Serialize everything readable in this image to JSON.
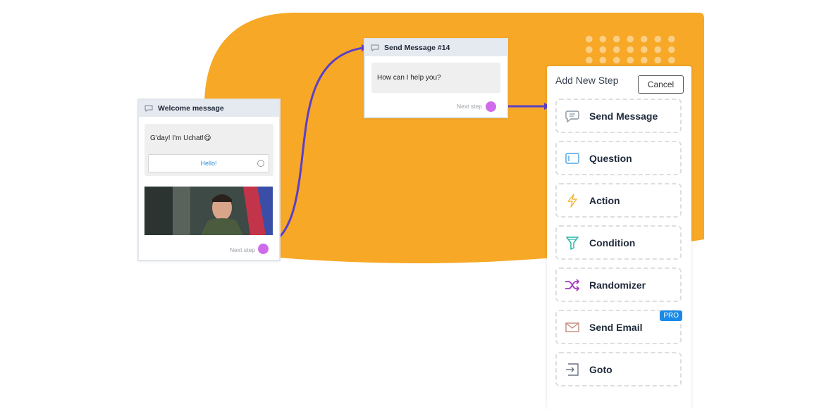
{
  "colors": {
    "accent_orange": "#f7a826",
    "connector_purple": "#5b3fc9",
    "port_magenta": "#cf6bea",
    "pro_badge": "#1a8ae8"
  },
  "welcome_node": {
    "title": "Welcome message",
    "message": "G'day! I'm Uchat!😋",
    "button_label": "Hello!",
    "next_step": "Next step"
  },
  "send_node": {
    "title": "Send Message #14",
    "message": "How can I help you?",
    "next_step": "Next step"
  },
  "add_step_panel": {
    "title": "Add New Step",
    "cancel_label": "Cancel",
    "steps": [
      {
        "label": "Send Message",
        "icon": "chat-bubble-icon"
      },
      {
        "label": "Question",
        "icon": "input-box-icon"
      },
      {
        "label": "Action",
        "icon": "lightning-icon"
      },
      {
        "label": "Condition",
        "icon": "filter-icon"
      },
      {
        "label": "Randomizer",
        "icon": "shuffle-icon"
      },
      {
        "label": "Send Email",
        "icon": "envelope-icon",
        "badge": "PRO"
      },
      {
        "label": "Goto",
        "icon": "arrow-into-box-icon"
      }
    ]
  }
}
